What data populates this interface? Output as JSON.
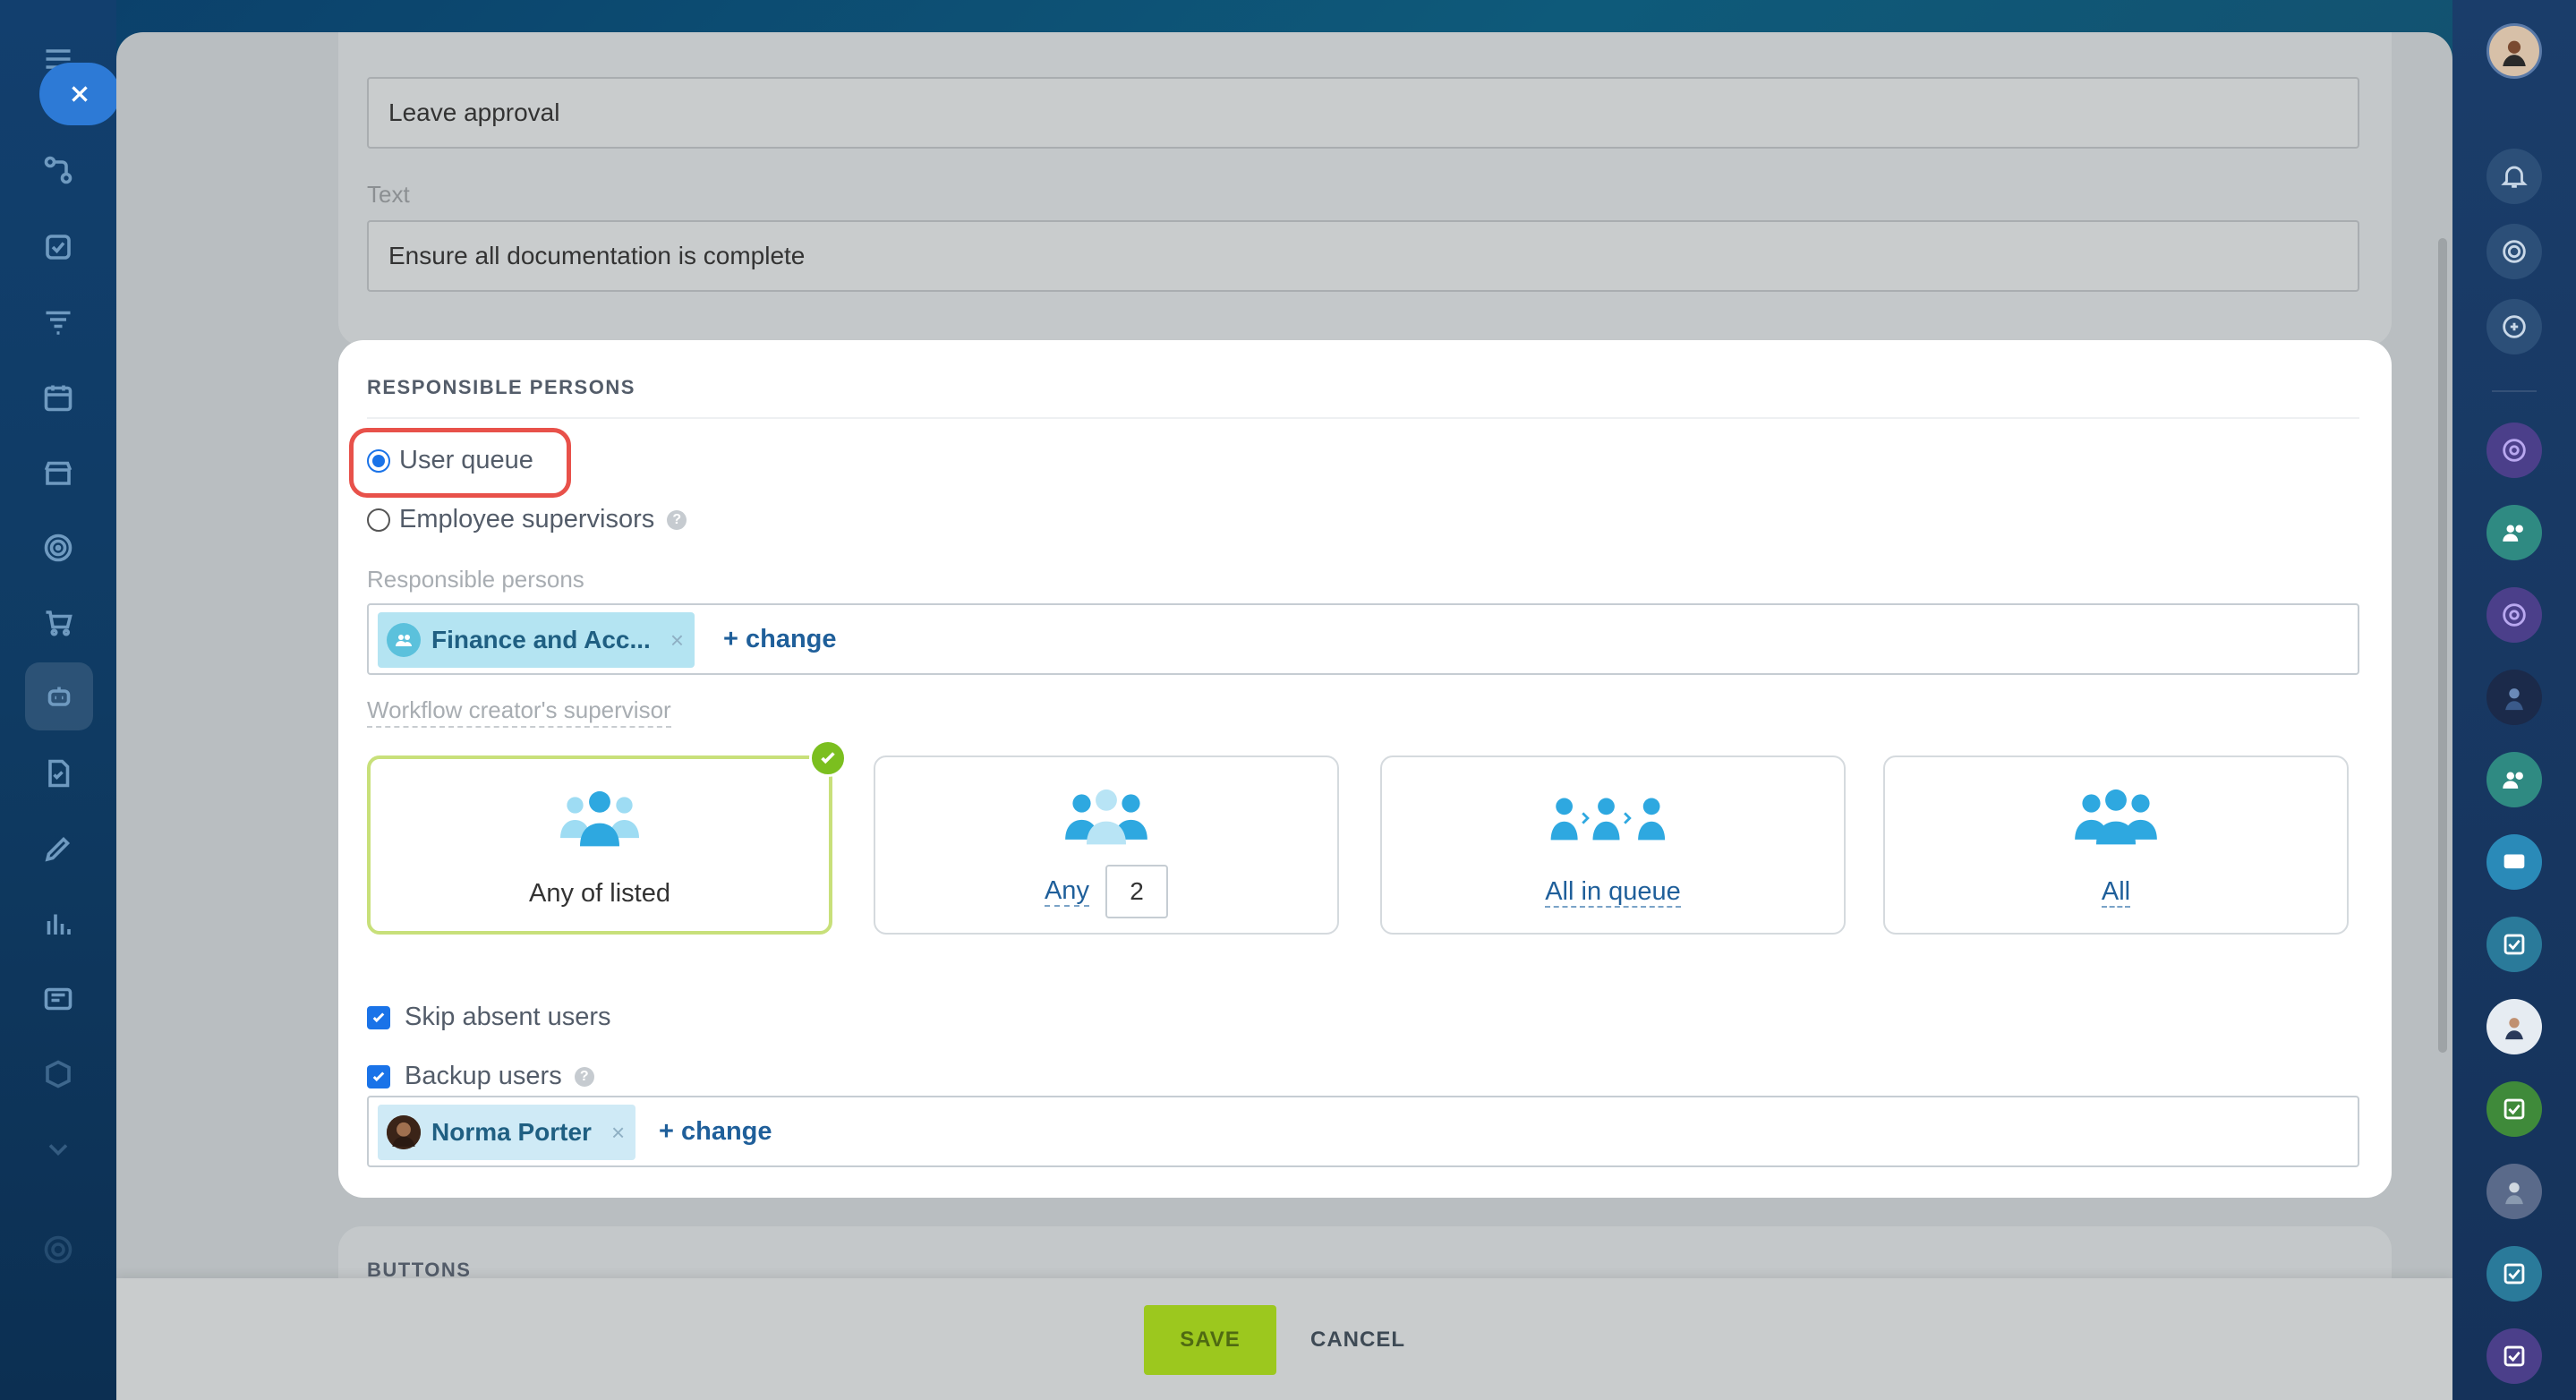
{
  "form": {
    "title_value": "Leave approval",
    "text_label": "Text",
    "text_value": "Ensure all documentation is complete"
  },
  "responsible": {
    "section_title": "RESPONSIBLE PERSONS",
    "radio_user_queue": "User queue",
    "radio_supervisors": "Employee supervisors",
    "help_glyph": "?",
    "responsible_label": "Responsible persons",
    "responsible_chip": "Finance and Acc...",
    "chip_remove": "×",
    "change_link": "+ change",
    "creator_supervisor_label": "Workflow creator's supervisor",
    "options": [
      {
        "label": "Any of listed",
        "selected": true
      },
      {
        "label": "Any",
        "count": "2",
        "selected": false
      },
      {
        "label": "All in queue",
        "selected": false
      },
      {
        "label": "All",
        "selected": false
      }
    ],
    "skip_absent": "Skip absent users",
    "backup_users": "Backup users",
    "backup_chip": "Norma Porter"
  },
  "buttons_section": {
    "title": "BUTTONS"
  },
  "footer": {
    "save": "SAVE",
    "cancel": "CANCEL"
  },
  "colors": {
    "accent": "#1a73e8",
    "save_green": "#9cc81e",
    "highlight": "#e8514a",
    "icon_blue": "#3bb7e8"
  }
}
